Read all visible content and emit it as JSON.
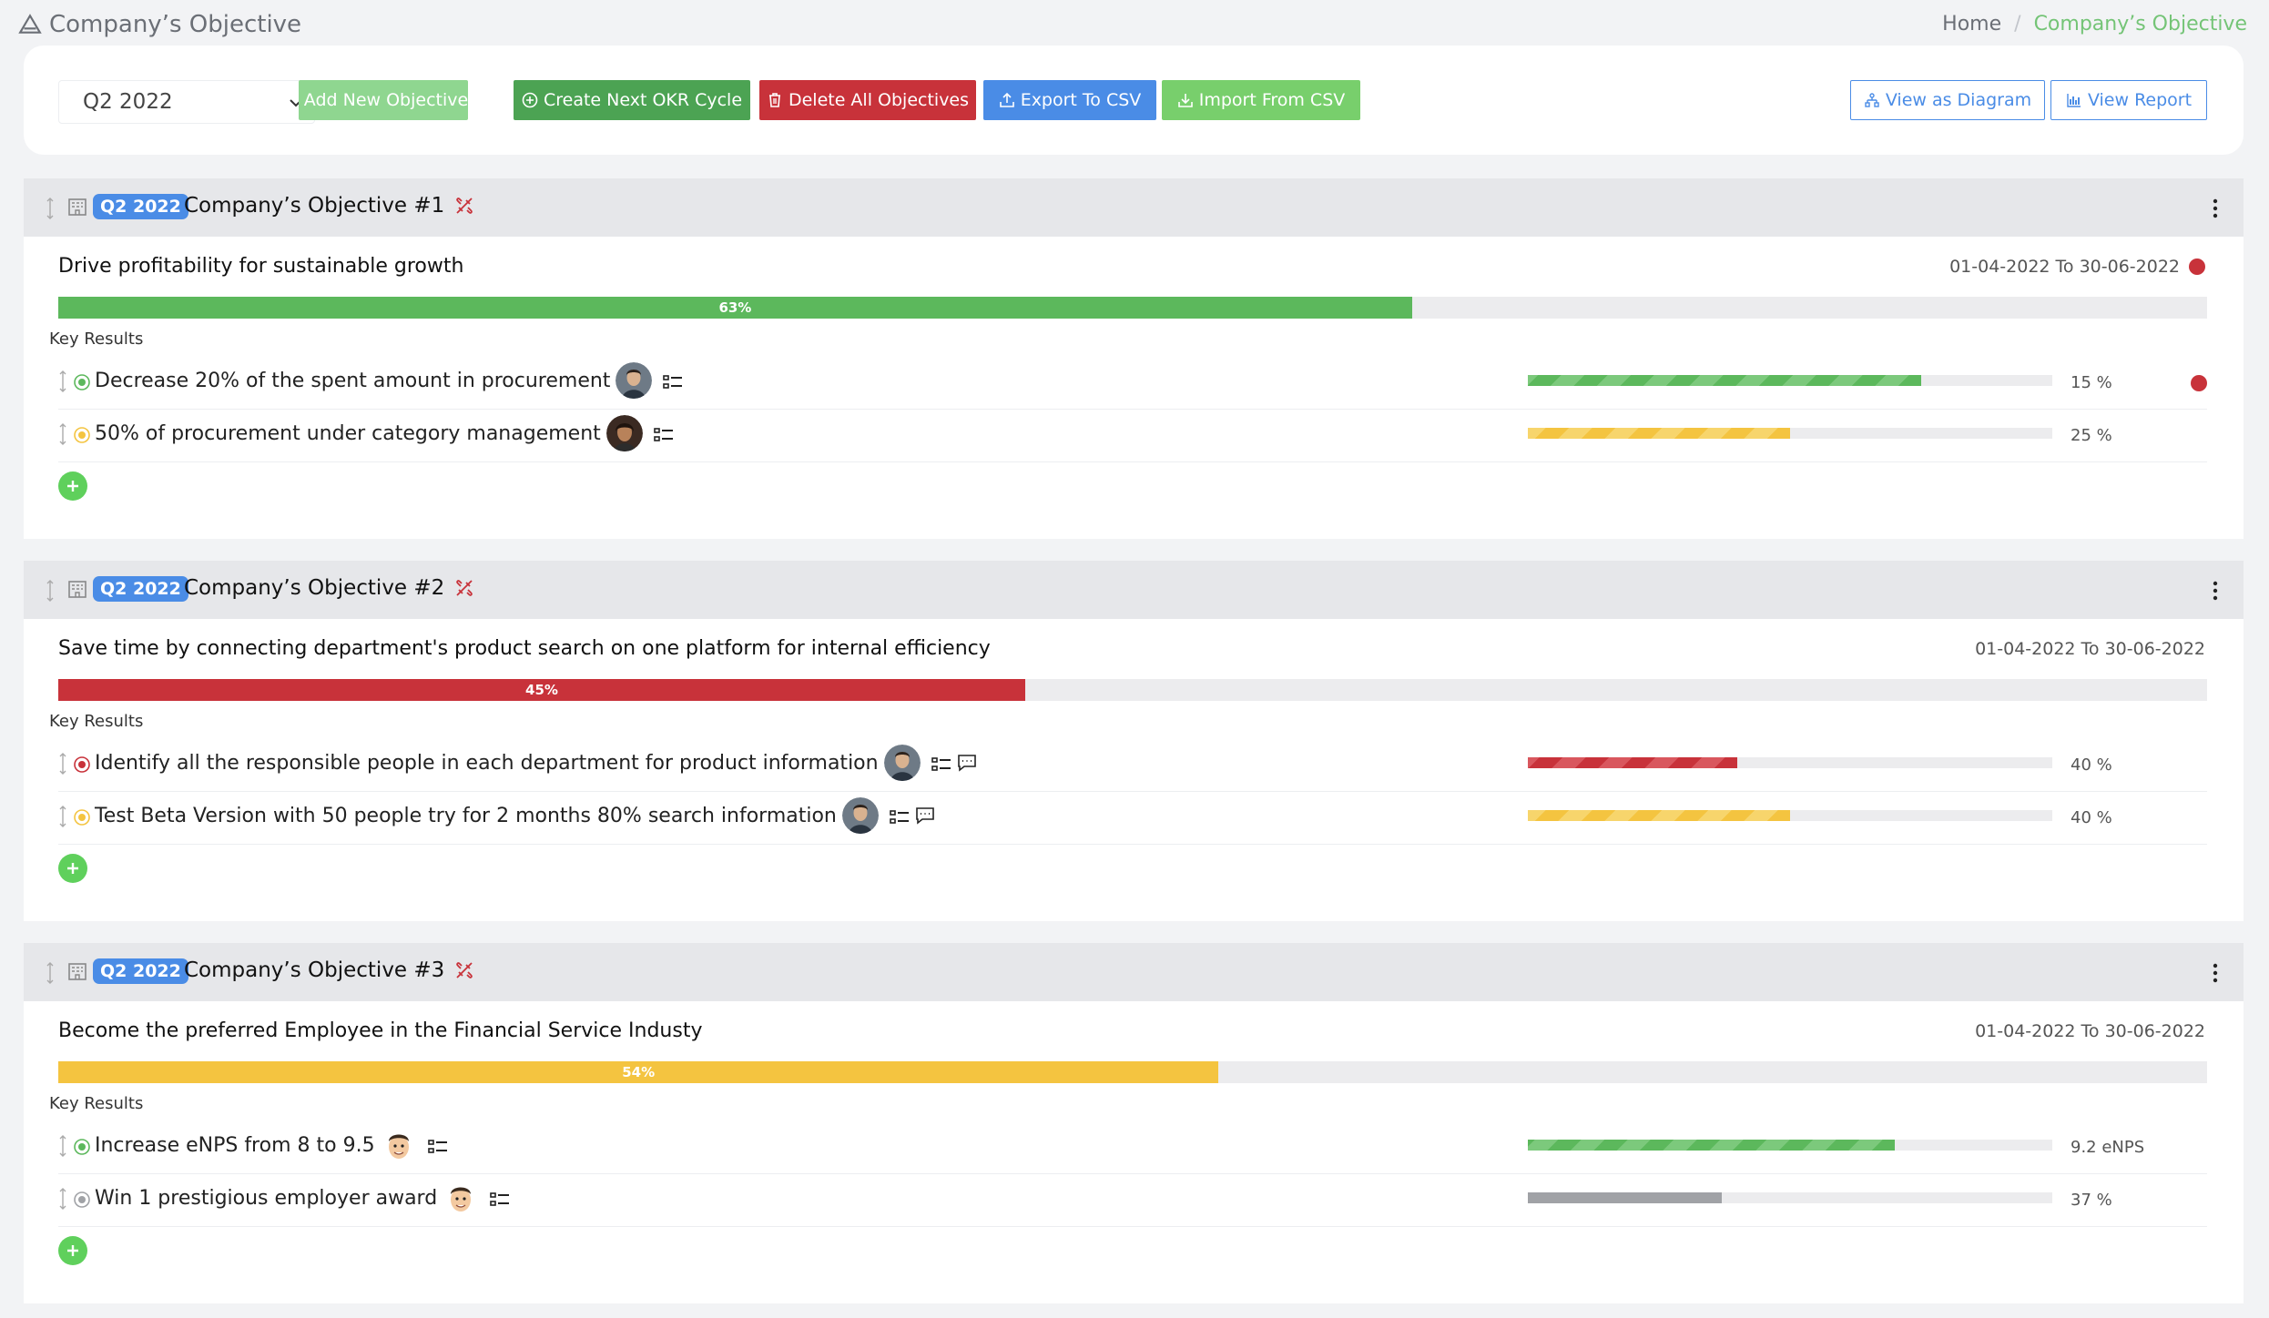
{
  "header": {
    "title": "Company’s Objective",
    "breadcrumb": {
      "home": "Home",
      "separator": "/",
      "current": "Company’s Objective"
    }
  },
  "toolbar": {
    "cycle_selected": "Q2 2022",
    "buttons": {
      "add_objective": "Add New Objective",
      "create_next_cycle": "Create Next OKR Cycle",
      "delete_all": "Delete All Objectives",
      "export_csv": "Export To CSV",
      "import_csv": "Import From CSV",
      "view_diagram": "View as Diagram",
      "view_report": "View Report"
    }
  },
  "colors": {
    "green": "#5cb85c",
    "red": "#c8323a",
    "yellow": "#f4c440",
    "blue": "#4a8ce6",
    "gray": "#a0a2a6"
  },
  "objectives": [
    {
      "cycle": "Q2 2022",
      "title": "Company’s Objective #1",
      "description": "Drive profitability for sustainable growth",
      "dates": "01-04-2022 To 30-06-2022",
      "status_dot": "red",
      "progress": 63,
      "progress_label": "63%",
      "progress_color": "green",
      "key_results_label": "Key Results",
      "key_results": [
        {
          "text": "Decrease 20% of the spent amount in procurement",
          "status": "green",
          "progress": 15,
          "bar_fill": 75,
          "value": "15 %",
          "color": "green",
          "avatar": "man-avatar",
          "has_comments": false,
          "status_dot": "red"
        },
        {
          "text": "50% of procurement under category management",
          "status": "yellow",
          "progress": 25,
          "bar_fill": 50,
          "value": "25 %",
          "color": "yellow",
          "avatar": "woman-avatar",
          "has_comments": false,
          "status_dot": ""
        }
      ]
    },
    {
      "cycle": "Q2 2022",
      "title": "Company’s Objective #2",
      "description": "Save time by connecting department's product search on one platform for internal efficiency",
      "dates": "01-04-2022 To 30-06-2022",
      "status_dot": "",
      "progress": 45,
      "progress_label": "45%",
      "progress_color": "red",
      "key_results_label": "Key Results",
      "key_results": [
        {
          "text": "Identify all the responsible people in each department for product information",
          "status": "red",
          "progress": 40,
          "bar_fill": 40,
          "value": "40 %",
          "color": "red",
          "avatar": "man-avatar",
          "has_comments": true,
          "status_dot": ""
        },
        {
          "text": "Test Beta Version with 50 people try for 2 months 80% search information",
          "status": "yellow",
          "progress": 40,
          "bar_fill": 50,
          "value": "40 %",
          "color": "yellow",
          "avatar": "man-avatar",
          "has_comments": true,
          "status_dot": ""
        }
      ]
    },
    {
      "cycle": "Q2 2022",
      "title": "Company’s Objective #3",
      "description": "Become the preferred Employee in the Financial Service Industy",
      "dates": "01-04-2022 To 30-06-2022",
      "status_dot": "",
      "progress": 54,
      "progress_label": "54%",
      "progress_color": "yellow",
      "key_results_label": "Key Results",
      "key_results": [
        {
          "text": "Increase eNPS from 8 to 9.5",
          "status": "green",
          "progress": 70,
          "bar_fill": 70,
          "value": "9.2 eNPS",
          "color": "green",
          "avatar": "emoji-avatar",
          "has_comments": false,
          "status_dot": ""
        },
        {
          "text": "Win 1 prestigious employer award",
          "status": "gray",
          "progress": 37,
          "bar_fill": 37,
          "value": "37 %",
          "color": "gray",
          "avatar": "emoji-avatar",
          "has_comments": false,
          "status_dot": ""
        }
      ]
    }
  ]
}
